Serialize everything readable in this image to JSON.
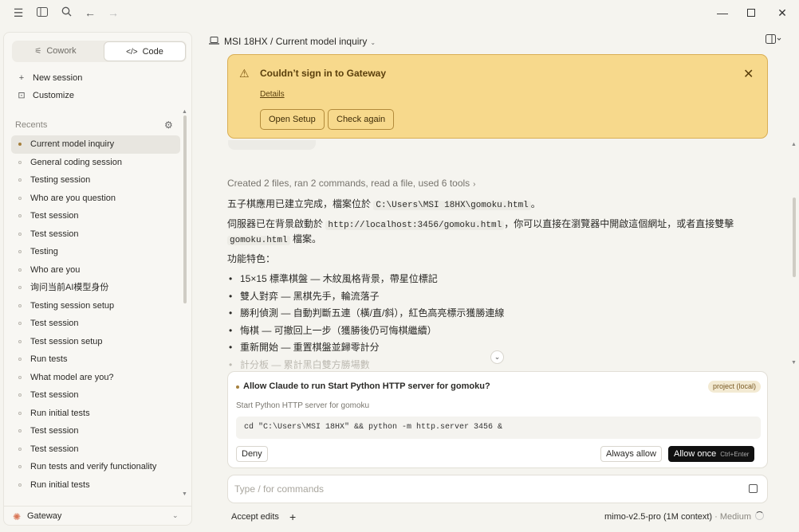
{
  "app": {
    "title": "MSI 18HX",
    "conversation_title": "Current model inquiry"
  },
  "sidebar": {
    "modes": {
      "cowork": "Cowork",
      "code": "Code"
    },
    "new_session": "New session",
    "customize": "Customize",
    "recents_label": "Recents",
    "recents": [
      "Current model inquiry",
      "General coding session",
      "Testing session",
      "Who are you question",
      "Test session",
      "Test session",
      "Testing",
      "Who are you",
      "询问当前AI模型身份",
      "Testing session setup",
      "Test session",
      "Test session setup",
      "Run tests",
      "What model are you?",
      "Test session",
      "Run initial tests",
      "Test session",
      "Test session",
      "Run tests and verify functionality",
      "Run initial tests"
    ],
    "gateway_label": "Gateway"
  },
  "banner": {
    "title": "Couldn’t sign in to Gateway",
    "details": "Details",
    "open_setup": "Open Setup",
    "check_again": "Check again"
  },
  "message": {
    "summary": "Created 2 files, ran 2 commands, read a file, used 6 tools",
    "p1_text": "五子棋應用已建立完成，檔案位於 ",
    "p1_code": "C:\\Users\\MSI 18HX\\gomoku.html",
    "p1_end": "。",
    "p2_text": "伺服器已在背景啟動於 ",
    "p2_code": "http://localhost:3456/gomoku.html",
    "p2_mid": "，你可以直接在瀏覽器中開啟這個網址，或者直接雙擊 ",
    "p2_code2": "gomoku.html",
    "p2_end": " 檔案。",
    "features_label": "功能特色：",
    "features": [
      "15×15 標準棋盤 — 木紋風格背景，帶星位標記",
      "雙人對弈 — 黑棋先手，輪流落子",
      "勝利偵測 — 自動判斷五連（橫/直/斜），紅色高亮標示獲勝連線",
      "悔棋 — 可撤回上一步（獲勝後仍可悔棋繼續）",
      "重新開始 — 重置棋盤並歸零計分",
      "計分板 — 累計黑白雙方勝場數"
    ]
  },
  "permission": {
    "title": "Allow Claude to run Start Python HTTP server for gomoku?",
    "badge": "project (local)",
    "subtitle": "Start Python HTTP server for gomoku",
    "command": "cd \"C:\\Users\\MSI 18HX\" && python -m http.server 3456 &",
    "deny": "Deny",
    "always_allow": "Always allow",
    "allow_once": "Allow once",
    "allow_once_shortcut": "Ctrl+Enter"
  },
  "input": {
    "placeholder": "Type / for commands"
  },
  "footer": {
    "accept_edits": "Accept edits",
    "model": "mimo-v2.5-pro (1M context)",
    "separator": " · ",
    "effort": "Medium"
  },
  "colors": {
    "banner_bg": "#f7d98c",
    "accent": "#a6803d",
    "primary_button": "#111111"
  }
}
